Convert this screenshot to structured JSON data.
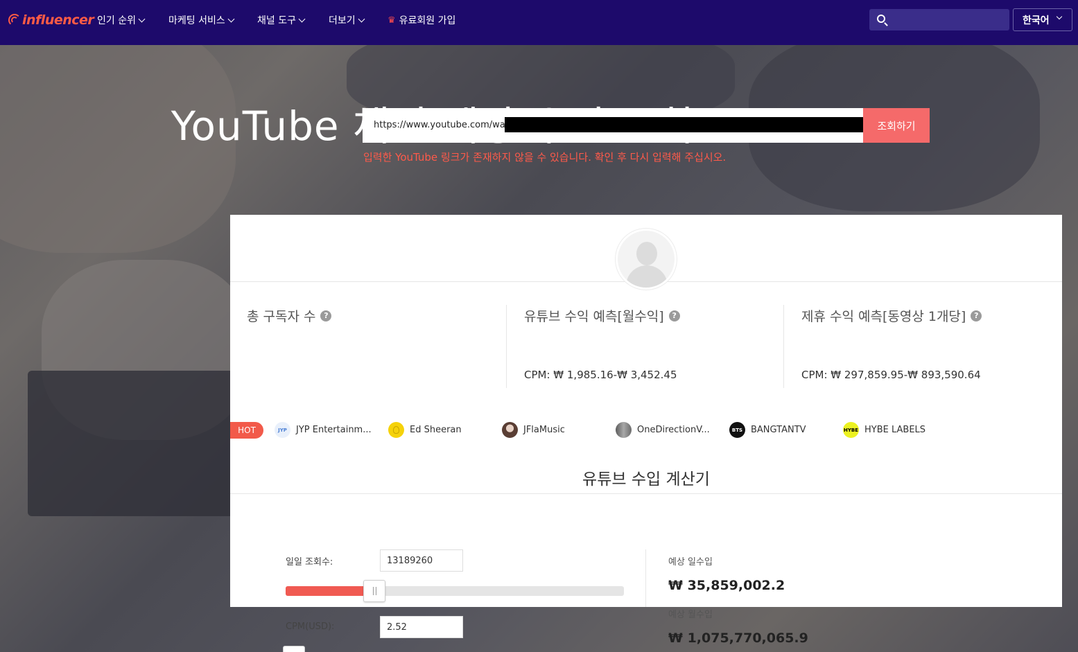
{
  "nav": {
    "logo_text": "influencer",
    "items": [
      {
        "label": "인기 순위"
      },
      {
        "label": "마케팅 서비스"
      },
      {
        "label": "채널 도구"
      },
      {
        "label": "더보기"
      }
    ],
    "premium_label": "유료회원 가입",
    "search_placeholder": "",
    "language": "한국어"
  },
  "hero": {
    "title": "YouTube 채널 예상 수입 조회",
    "url_value": "https://www.youtube.com/watc",
    "lookup_button": "조회하기",
    "error_message": "입력한 YouTube 링크가 존재하지 않을 수 있습니다. 확인 후 다시 입력해 주십시오."
  },
  "stats": {
    "subscribers_label": "총 구독자 수",
    "youtube_revenue_label": "유튜브 수익 예측[월수익]",
    "youtube_revenue_cpm": "CPM: ₩ 1,985.16-₩ 3,452.45",
    "affiliate_revenue_label": "제휴 수익 예측[동영상 1개당]",
    "affiliate_revenue_cpm": "CPM: ₩ 297,859.95-₩ 893,590.64",
    "help_glyph": "?"
  },
  "hot": {
    "badge": "HOT",
    "channels": [
      {
        "name": "JYP Entertainm...",
        "icon": "jyp-logo-icon",
        "icon_text": "JYP",
        "color": "#e9f0fb",
        "text_color": "#4a7fd4"
      },
      {
        "name": "Ed Sheeran",
        "icon": "ed-sheeran-logo-icon",
        "icon_text": "",
        "color": "#f5d20a",
        "text_color": "#000"
      },
      {
        "name": "JFlaMusic",
        "icon": "jfla-avatar-icon",
        "icon_text": "",
        "color": "#8a6a5c",
        "text_color": "#fff"
      },
      {
        "name": "OneDirectionV...",
        "icon": "one-direction-avatar-icon",
        "icon_text": "",
        "color": "#7a7a7a",
        "text_color": "#fff"
      },
      {
        "name": "BANGTANTV",
        "icon": "bts-logo-icon",
        "icon_text": "BTS",
        "color": "#111111",
        "text_color": "#fff"
      },
      {
        "name": "HYBE LABELS",
        "icon": "hybe-logo-icon",
        "icon_text": "HYBE",
        "color": "#ecf221",
        "text_color": "#000"
      }
    ]
  },
  "calculator": {
    "title": "유튜브 수입 계산기",
    "daily_views_label": "일일 조회수:",
    "daily_views_value": "13189260",
    "daily_views_slider_fraction": 0.262,
    "cpm_label": "CPM(USD):",
    "cpm_value": "2.52",
    "daily_income_label": "예상 일수입",
    "daily_income_value": "₩ 35,859,002.2",
    "monthly_income_label": "예상 월수입",
    "monthly_income_value": "₩ 1,075,770,065.9"
  },
  "colors": {
    "nav_bg": "#1d0a6b",
    "accent": "#f56a6a",
    "error": "#ff5a4a",
    "logo": "#ff5b45"
  }
}
